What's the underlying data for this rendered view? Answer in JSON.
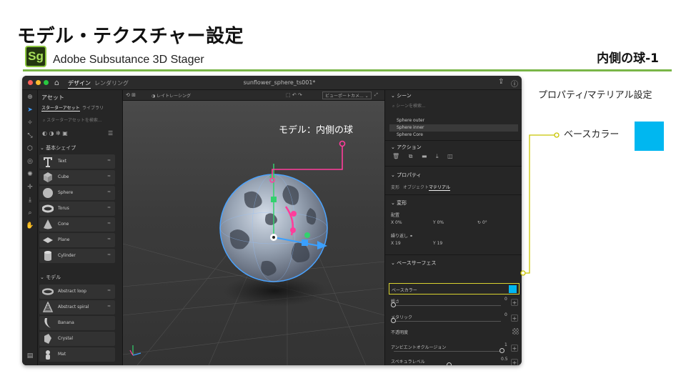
{
  "slide": {
    "title": "モデル・テクスチャー設定",
    "app_logo_text": "Sg",
    "app_name": "Adobe Subsutance 3D Stager",
    "section_title": "内側の球-1",
    "right_caption": "プロパティ/マテリアル設定",
    "base_color_label": "ベースカラー",
    "base_color_hex": "#00b7f0",
    "accent_green": "#7ab648"
  },
  "window": {
    "tabs": [
      "デザイン",
      "レンダリング"
    ],
    "document_title": "sunflower_sphere_ts001*",
    "icons": [
      "home-icon",
      "share-icon",
      "help-icon"
    ]
  },
  "assets_panel": {
    "heading": "アセット",
    "subtabs": [
      "スターターアセット",
      "ライブラリ"
    ],
    "search_placeholder": "スターターアセットを検索...",
    "groups": [
      {
        "title": "基本シェイプ",
        "items": [
          "Text",
          "Cube",
          "Sphere",
          "Torus",
          "Cone",
          "Plane",
          "Cylinder"
        ]
      },
      {
        "title": "モデル",
        "items": [
          "Abstract loop",
          "Abstract spiral",
          "Banana",
          "Crystal",
          "Mat"
        ]
      }
    ]
  },
  "viewport": {
    "raytrace_label": "レイトレーシング",
    "camera_label": "ビューポートカメ...",
    "model_caption": "モデル：内側の球"
  },
  "right_panel": {
    "scene_heading": "シーン",
    "scene_search_placeholder": "シーンを検索...",
    "scene_items": [
      "Sphere outer",
      "Sphere inner",
      "Sphere Core"
    ],
    "action_heading": "アクション",
    "property_heading": "プロパティ",
    "property_tabs": [
      "変形",
      "オブジェクト",
      "マテリアル"
    ],
    "transform_heading": "変形",
    "offset_label": "配置",
    "offset_x": "X 0%",
    "offset_y": "Y 0%",
    "rotation": "0°",
    "repeat_label": "繰り返し",
    "repeat_x": "X 19",
    "repeat_y": "Y 19",
    "base_surface_heading": "ベースサーフェス",
    "base_color_row": "ベースカラー",
    "roughness_label": "粗さ",
    "roughness_value": "0",
    "metallic_label": "メタリック",
    "metallic_value": "0",
    "opacity_label": "不透明度",
    "ao_label": "アンビエントオクルージョン",
    "ao_value": "1",
    "specular_label": "スペキュラレベル",
    "specular_value": "0.5"
  }
}
